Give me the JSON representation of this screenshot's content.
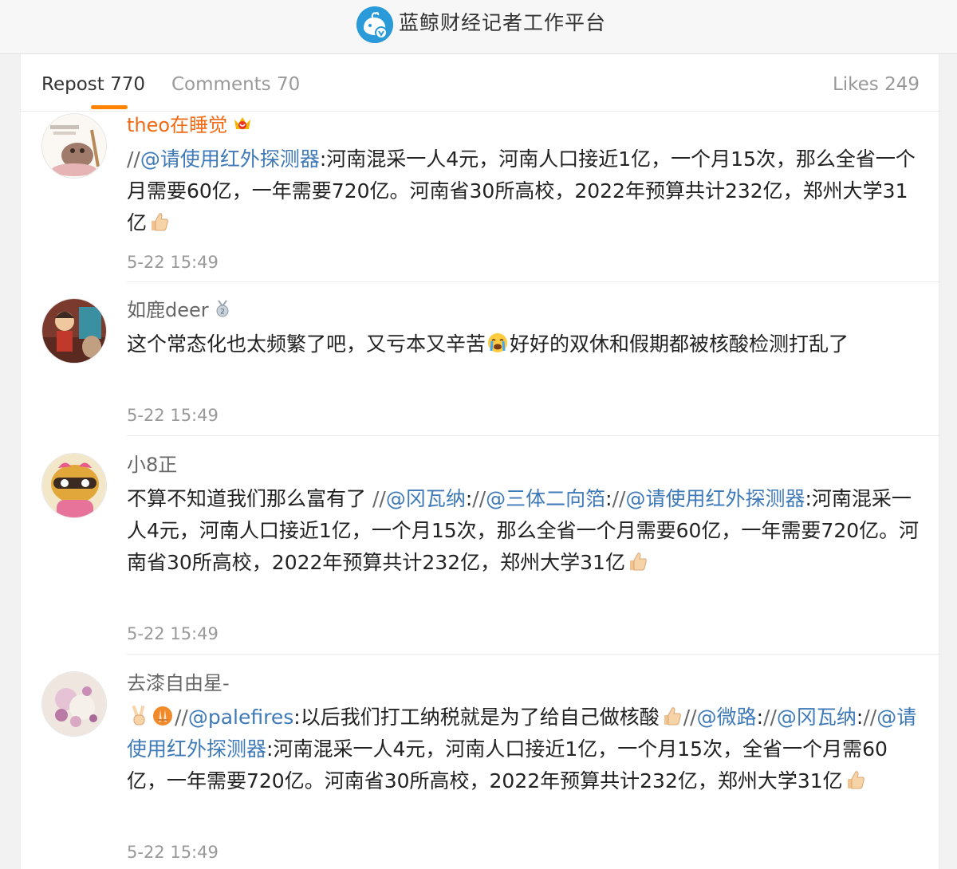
{
  "platform": {
    "title": "蓝鲸财经记者工作平台"
  },
  "tabs": {
    "repost": "Repost 770",
    "comments": "Comments 70",
    "likes": "Likes 249"
  },
  "comments": [
    {
      "username": "theo在睡觉",
      "segments": [
        {
          "t": "//",
          "k": "slash"
        },
        {
          "t": "@请使用红外探测器",
          "k": "mention"
        },
        {
          "t": ":河南混采一人4元，河南人口接近1亿，一个月15次，那么全省一个月需要60亿，一年需要720亿。河南省30所高校，2022年预算共计232亿，郑州大学31亿",
          "k": "text"
        }
      ],
      "end_emoji": "thumbs-up-emoji",
      "time": "5-22 15:49"
    },
    {
      "username": "如鹿deer",
      "segments": [
        {
          "t": "这个常态化也太频繁了吧，又亏本又辛苦",
          "k": "text"
        },
        {
          "t": "",
          "k": "emoji",
          "icon": "crying-face-emoji"
        },
        {
          "t": "好好的双休和假期都被核酸检测打乱了",
          "k": "text"
        }
      ],
      "time": "5-22 15:49"
    },
    {
      "username": "小8正",
      "segments": [
        {
          "t": "不算不知道我们那么富有了 ",
          "k": "text"
        },
        {
          "t": "//",
          "k": "slash"
        },
        {
          "t": "@冈瓦纳",
          "k": "mention"
        },
        {
          "t": ":",
          "k": "text"
        },
        {
          "t": "//",
          "k": "slash"
        },
        {
          "t": "@三体二向箔",
          "k": "mention"
        },
        {
          "t": ":",
          "k": "text"
        },
        {
          "t": "//",
          "k": "slash"
        },
        {
          "t": "@请使用红外探测器",
          "k": "mention"
        },
        {
          "t": ":河南混采一人4元，河南人口接近1亿，一个月15次，那么全省一个月需要60亿，一年需要720亿。河南省30所高校，2022年预算共计232亿，郑州大学31亿",
          "k": "text"
        }
      ],
      "end_emoji": "thumbs-up-emoji",
      "time": "5-22 15:49"
    },
    {
      "username": "去漆自由星-",
      "segments": [
        {
          "t": "",
          "k": "emoji",
          "icon": "peace-hand-emoji"
        },
        {
          "t": "",
          "k": "emoji",
          "icon": "folded-hands-emoji"
        },
        {
          "t": "//",
          "k": "slash"
        },
        {
          "t": "@palefires",
          "k": "mention"
        },
        {
          "t": ":以后我们打工纳税就是为了给自己做核酸",
          "k": "text"
        },
        {
          "t": "",
          "k": "emoji",
          "icon": "thumbs-up-emoji"
        },
        {
          "t": "//",
          "k": "slash"
        },
        {
          "t": "@微路",
          "k": "mention"
        },
        {
          "t": ":",
          "k": "text"
        },
        {
          "t": "//",
          "k": "slash"
        },
        {
          "t": "@冈瓦纳",
          "k": "mention"
        },
        {
          "t": ":",
          "k": "text"
        },
        {
          "t": "//",
          "k": "slash"
        },
        {
          "t": "@请使用红外探测器",
          "k": "mention"
        },
        {
          "t": ":河南混采一人4元，河南人口接近1亿，一个月15次，全省一个月需60亿，一年需要720亿。河南省30所高校，2022年预算共计232亿，郑州大学31亿",
          "k": "text"
        }
      ],
      "end_emoji": "thumbs-up-emoji",
      "time": "5-22 15:49"
    }
  ],
  "colors": {
    "accent": "#ff8200",
    "mention": "#3f7ab8",
    "vip_name": "#f06a14",
    "muted": "#999999"
  }
}
